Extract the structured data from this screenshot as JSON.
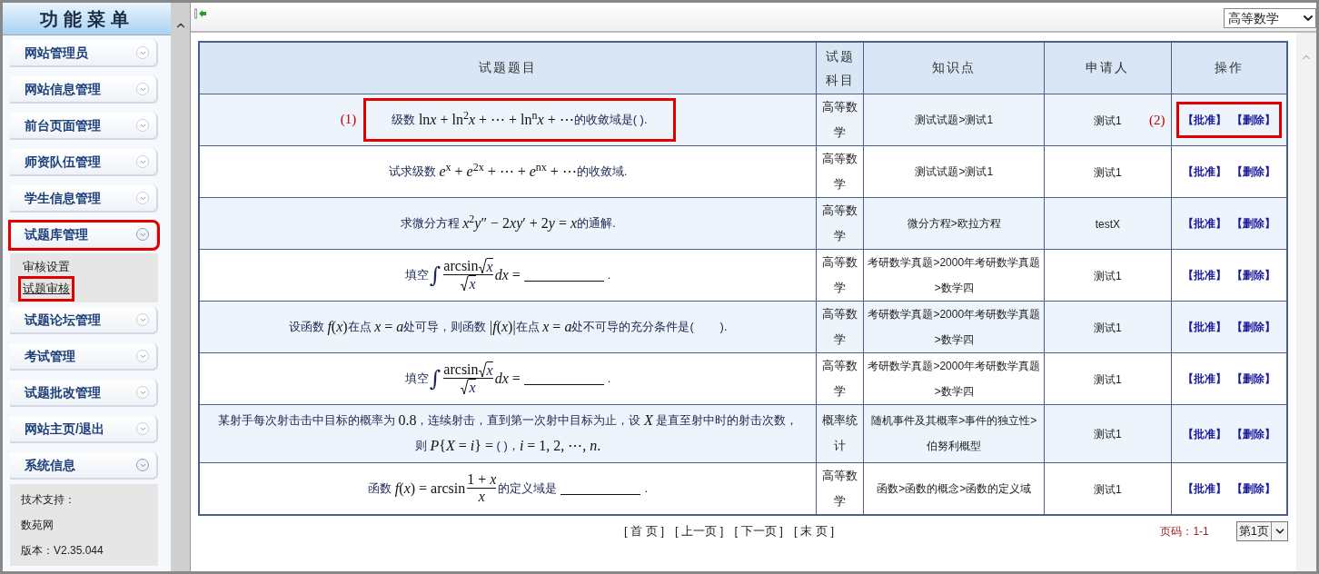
{
  "sidebar": {
    "title": "功能菜单",
    "items": [
      {
        "label": "网站管理员",
        "expanded": false,
        "highlighted": false
      },
      {
        "label": "网站信息管理",
        "expanded": false,
        "highlighted": false
      },
      {
        "label": "前台页面管理",
        "expanded": false,
        "highlighted": false
      },
      {
        "label": "师资队伍管理",
        "expanded": false,
        "highlighted": false
      },
      {
        "label": "学生信息管理",
        "expanded": false,
        "highlighted": false
      },
      {
        "label": "试题库管理",
        "expanded": true,
        "highlighted": true,
        "children": [
          {
            "kind": "link",
            "label": "审核设置",
            "selected": false,
            "highlighted": false
          },
          {
            "kind": "link",
            "label": "试题审核",
            "selected": true,
            "highlighted": true
          }
        ]
      },
      {
        "label": "试题论坛管理",
        "expanded": false,
        "highlighted": false
      },
      {
        "label": "考试管理",
        "expanded": false,
        "highlighted": false
      },
      {
        "label": "试题批改管理",
        "expanded": false,
        "highlighted": false
      },
      {
        "label": "网站主页/退出",
        "expanded": false,
        "highlighted": false
      },
      {
        "label": "系统信息",
        "expanded": true,
        "highlighted": false,
        "children": [
          {
            "kind": "info",
            "label": "技术支持："
          },
          {
            "kind": "info",
            "label": "数苑网"
          },
          {
            "kind": "info",
            "label": "版本：V2.35.044"
          }
        ]
      }
    ]
  },
  "toolbar": {
    "subject_select": {
      "value": "高等数学"
    }
  },
  "table": {
    "columns": [
      "试题题目",
      "试题科目",
      "知识点",
      "申请人",
      "操作"
    ],
    "rows": [
      {
        "question": [
          [
            {
              "kind": "text",
              "s": "级数 "
            },
            {
              "kind": "math",
              "s": "ln"
            },
            {
              "kind": "var",
              "s": "x"
            },
            {
              "kind": "math",
              "s": " + ln$^{2}$*x* + ⋯ + ln$^{n}$*x* + ⋯"
            },
            {
              "kind": "text",
              "s": "的收敛域是( )."
            }
          ]
        ],
        "question_marker": "(1)",
        "question_highlighted": true,
        "subject": "高等数学",
        "topic": "测试试题>测试1",
        "applicant": "测试1",
        "actions_marker": "(2)",
        "actions_highlighted": true,
        "actions": [
          "【批准】",
          "【删除】"
        ]
      },
      {
        "question": [
          [
            {
              "kind": "text",
              "s": "试求级数 "
            },
            {
              "kind": "math",
              "s": "*e*$^{x}$ + *e*$^{2x}$ + ⋯ + *e*$^{nx}$ + ⋯"
            },
            {
              "kind": "text",
              "s": "的收敛域."
            }
          ]
        ],
        "question_highlighted": false,
        "subject": "高等数学",
        "topic": "测试试题>测试1",
        "applicant": "测试1",
        "actions_highlighted": false,
        "actions": [
          "【批准】",
          "【删除】"
        ]
      },
      {
        "question": [
          [
            {
              "kind": "text",
              "s": "求微分方程 "
            },
            {
              "kind": "math",
              "s": "*x*$^{2}$*y*″ − 2"
            },
            {
              "kind": "var",
              "s": "xy"
            },
            {
              "kind": "math",
              "s": "′ + 2"
            },
            {
              "kind": "var",
              "s": "y"
            },
            {
              "kind": "math",
              "s": " = *x*"
            },
            {
              "kind": "text",
              "s": "的通解."
            }
          ]
        ],
        "question_highlighted": false,
        "subject": "高等数学",
        "topic": "微分方程>欧拉方程",
        "applicant": "testX",
        "actions_highlighted": false,
        "actions": [
          "【批准】",
          "【删除】"
        ]
      },
      {
        "question": [
          [
            {
              "kind": "text",
              "s": "填空"
            },
            {
              "kind": "integral",
              "s": "∫"
            },
            {
              "kind": "frac",
              "num": [
                {
                  "kind": "math",
                  "s": "arcsin"
                },
                {
                  "kind": "sqrt",
                  "s": "*x*"
                }
              ],
              "den": [
                {
                  "kind": "sqrt",
                  "s": "*x*"
                }
              ]
            },
            {
              "kind": "math",
              "s": "*dx* ="
            },
            {
              "kind": "blank"
            },
            {
              "kind": "text",
              "s": "."
            }
          ]
        ],
        "question_highlighted": false,
        "subject": "高等数学",
        "topic": "考研数学真题>2000年考研数学真题>数学四",
        "applicant": "测试1",
        "actions_highlighted": false,
        "actions": [
          "【批准】",
          "【删除】"
        ]
      },
      {
        "question": [
          [
            {
              "kind": "text",
              "s": "设函数 "
            },
            {
              "kind": "math",
              "s": "*f*(*x*)"
            },
            {
              "kind": "text",
              "s": "在点 "
            },
            {
              "kind": "math",
              "s": "*x* = *a*"
            },
            {
              "kind": "text",
              "s": "处可导，则函数 "
            },
            {
              "kind": "math",
              "s": "|*f*(*x*)|"
            },
            {
              "kind": "text",
              "s": "在点 "
            },
            {
              "kind": "math",
              "s": "*x* = *a*"
            },
            {
              "kind": "text",
              "s": "处不可导的充分条件是(        )."
            }
          ]
        ],
        "question_highlighted": false,
        "subject": "高等数学",
        "topic": "考研数学真题>2000年考研数学真题>数学四",
        "applicant": "测试1",
        "actions_highlighted": false,
        "actions": [
          "【批准】",
          "【删除】"
        ]
      },
      {
        "question": [
          [
            {
              "kind": "text",
              "s": "填空"
            },
            {
              "kind": "integral",
              "s": "∫"
            },
            {
              "kind": "frac",
              "num": [
                {
                  "kind": "math",
                  "s": "arcsin"
                },
                {
                  "kind": "sqrt",
                  "s": "*x*"
                }
              ],
              "den": [
                {
                  "kind": "sqrt",
                  "s": "*x*"
                }
              ]
            },
            {
              "kind": "math",
              "s": "*dx* ="
            },
            {
              "kind": "blank"
            },
            {
              "kind": "text",
              "s": "."
            }
          ]
        ],
        "question_highlighted": false,
        "subject": "高等数学",
        "topic": "考研数学真题>2000年考研数学真题>数学四",
        "applicant": "测试1",
        "actions_highlighted": false,
        "actions": [
          "【批准】",
          "【删除】"
        ]
      },
      {
        "question": [
          [
            {
              "kind": "text",
              "s": "某射手每次射击击中目标的概率为 "
            },
            {
              "kind": "math",
              "s": "0.8"
            },
            {
              "kind": "text",
              "s": "，连续射击，直到第一次射中目标为止，设 "
            },
            {
              "kind": "math",
              "s": "*X*"
            },
            {
              "kind": "text",
              "s": " 是直至射中时的射击次数，"
            }
          ],
          [
            {
              "kind": "text",
              "s": "则 "
            },
            {
              "kind": "math",
              "s": "*P*{*X* = *i*} ="
            },
            {
              "kind": "text",
              "s": " ( )，"
            },
            {
              "kind": "math",
              "s": "*i* = 1, 2, ⋯, *n*."
            }
          ]
        ],
        "question_highlighted": false,
        "subject": "概率统计",
        "topic": "随机事件及其概率>事件的独立性>伯努利概型",
        "applicant": "测试1",
        "actions_highlighted": false,
        "actions": [
          "【批准】",
          "【删除】"
        ]
      },
      {
        "question": [
          [
            {
              "kind": "text",
              "s": "函数 "
            },
            {
              "kind": "math",
              "s": "*f*(*x*) = arcsin"
            },
            {
              "kind": "frac",
              "num": [
                {
                  "kind": "math",
                  "s": "1 + *x*"
                }
              ],
              "den": [
                {
                  "kind": "math",
                  "s": "*x*"
                }
              ]
            },
            {
              "kind": "text",
              "s": "的定义域是"
            },
            {
              "kind": "blank"
            },
            {
              "kind": "text",
              "s": "."
            }
          ]
        ],
        "question_highlighted": false,
        "subject": "高等数学",
        "topic": "函数>函数的概念>函数的定义域",
        "applicant": "测试1",
        "actions_highlighted": false,
        "actions": [
          "【批准】",
          "【删除】"
        ]
      }
    ]
  },
  "pagination": {
    "links": [
      "[ 首 页 ]",
      "[ 上一页 ]",
      "[ 下一页 ]",
      "[ 末 页 ]"
    ],
    "page_info": "页码：1-1",
    "page_select": {
      "value": "第1页"
    }
  }
}
